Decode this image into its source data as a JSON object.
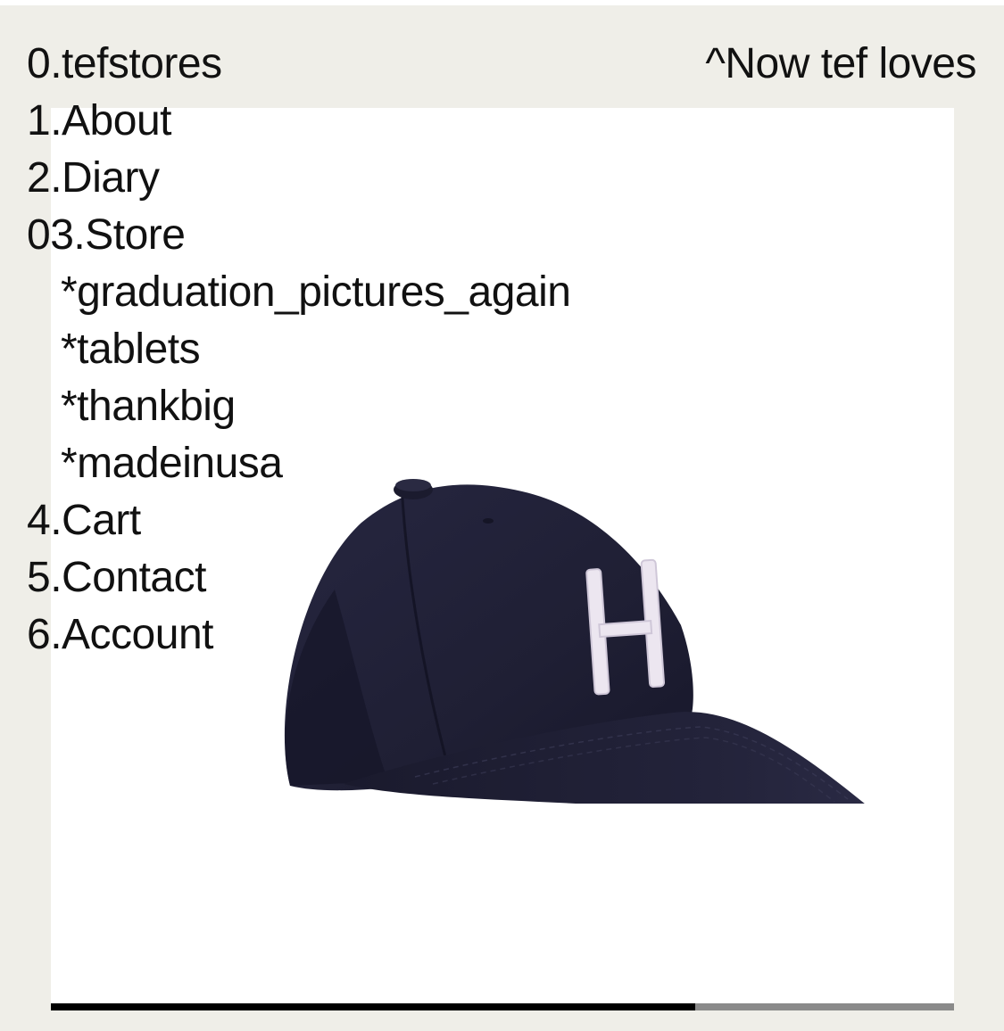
{
  "header": {
    "brand": "0.tefstores",
    "now_link": "^Now tef loves"
  },
  "nav": {
    "items": [
      {
        "label": "1.About"
      },
      {
        "label": "2.Diary"
      },
      {
        "label": "03.Store"
      }
    ],
    "store_sub": [
      {
        "label": "*graduation_pictures_again"
      },
      {
        "label": "*tablets"
      },
      {
        "label": "*thankbig"
      },
      {
        "label": "*madeinusa"
      }
    ],
    "after": [
      {
        "label": "4.Cart"
      },
      {
        "label": "5.Contact"
      },
      {
        "label": "6.Account"
      }
    ]
  },
  "product_image": {
    "subject": "navy baseball cap with white H embroidery",
    "cap_color": "#1f1f33",
    "logo_color": "#ece6f0",
    "logo_letter": "H"
  },
  "slideshow": {
    "progress": 0.713
  },
  "colors": {
    "background": "#efeee8",
    "text": "#111111",
    "progress_fill": "#000000",
    "progress_track": "#8a8a8a"
  }
}
